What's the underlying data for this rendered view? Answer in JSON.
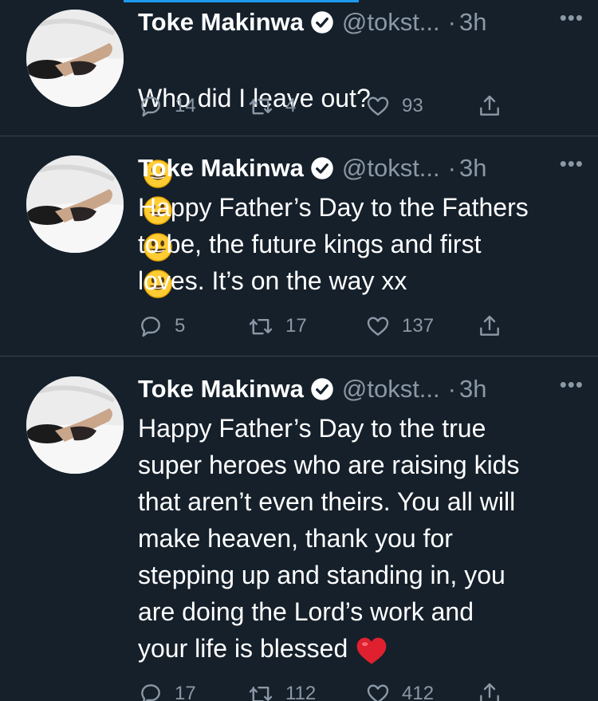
{
  "accent_color": "#1d9bf0",
  "tweets": [
    {
      "name": "Toke Makinwa",
      "handle": "@tokst...",
      "separator": "·",
      "time": "3h",
      "more": "•••",
      "text": "Who did I leave out?",
      "emoji": [
        "grinning-face",
        "grinning-face",
        "grinning-face",
        "grinning-face"
      ],
      "reply_count": "14",
      "retweet_count": "4",
      "like_count": "93"
    },
    {
      "name": "Toke Makinwa",
      "handle": "@tokst...",
      "separator": "·",
      "time": "3h",
      "more": "•••",
      "text": "Happy Father’s Day to the Fathers\nto be, the future kings and first\nloves. It’s on the way xx",
      "reply_count": "5",
      "retweet_count": "17",
      "like_count": "137"
    },
    {
      "name": "Toke Makinwa",
      "handle": "@tokst...",
      "separator": "·",
      "time": "3h",
      "more": "•••",
      "text": "Happy Father’s Day to the true\nsuper heroes who are raising kids\nthat aren’t even theirs. You all will\nmake heaven, thank you for\nstepping up and standing in, you\nare doing the Lord’s work and\nyour life is blessed",
      "trailing_emoji": "red-heart",
      "reply_count": "17",
      "retweet_count": "112",
      "like_count": "412"
    }
  ]
}
